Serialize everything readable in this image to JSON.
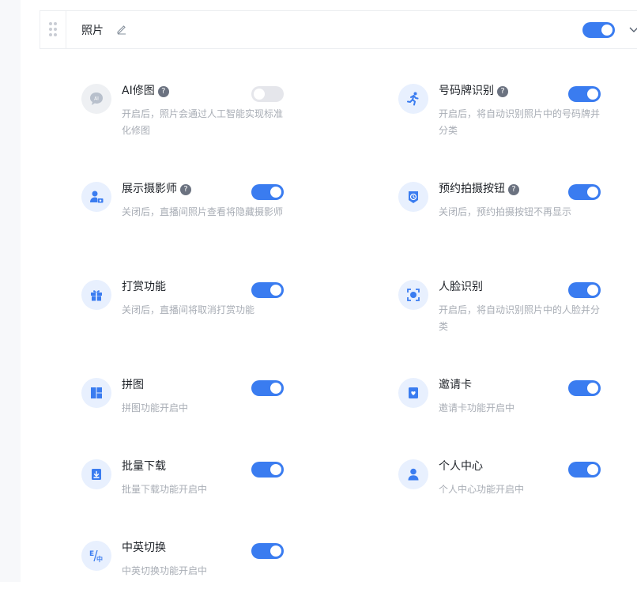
{
  "header": {
    "title": "照片"
  },
  "colors": {
    "accent": "#3a7cf0",
    "icon_bg": "#e8f0fe",
    "toggle_off": "#e5e6eb"
  },
  "features": [
    {
      "name": "AI修图",
      "help": true,
      "enabled": false,
      "icon": "ai-chat-icon",
      "desc": "开启后，照片会通过人工智能实现标准化修图"
    },
    {
      "name": "号码牌识别",
      "help": true,
      "enabled": true,
      "icon": "running-person-icon",
      "desc": "开启后，将自动识别照片中的号码牌并分类"
    },
    {
      "name": "展示摄影师",
      "help": true,
      "enabled": true,
      "icon": "photographer-icon",
      "desc": "关闭后，直播间照片查看将隐藏摄影师"
    },
    {
      "name": "预约拍摄按钮",
      "help": true,
      "enabled": true,
      "icon": "appointment-clock-icon",
      "desc": "关闭后，预约拍摄按钮不再显示"
    },
    {
      "name": "打赏功能",
      "help": false,
      "enabled": true,
      "icon": "gift-icon",
      "desc": "关闭后，直播间将取消打赏功能"
    },
    {
      "name": "人脸识别",
      "help": false,
      "enabled": true,
      "icon": "face-scan-icon",
      "desc": "开启后，将自动识别照片中的人脸并分类"
    },
    {
      "name": "拼图",
      "help": false,
      "enabled": true,
      "icon": "collage-icon",
      "desc": "拼图功能开启中"
    },
    {
      "name": "邀请卡",
      "help": false,
      "enabled": true,
      "icon": "invitation-card-icon",
      "desc": "邀请卡功能开启中"
    },
    {
      "name": "批量下载",
      "help": false,
      "enabled": true,
      "icon": "download-icon",
      "desc": "批量下载功能开启中"
    },
    {
      "name": "个人中心",
      "help": false,
      "enabled": true,
      "icon": "user-icon",
      "desc": "个人中心功能开启中"
    },
    {
      "name": "中英切换",
      "help": false,
      "enabled": true,
      "icon": "language-switch-icon",
      "desc": "中英切换功能开启中"
    }
  ],
  "help_glyph": "?"
}
